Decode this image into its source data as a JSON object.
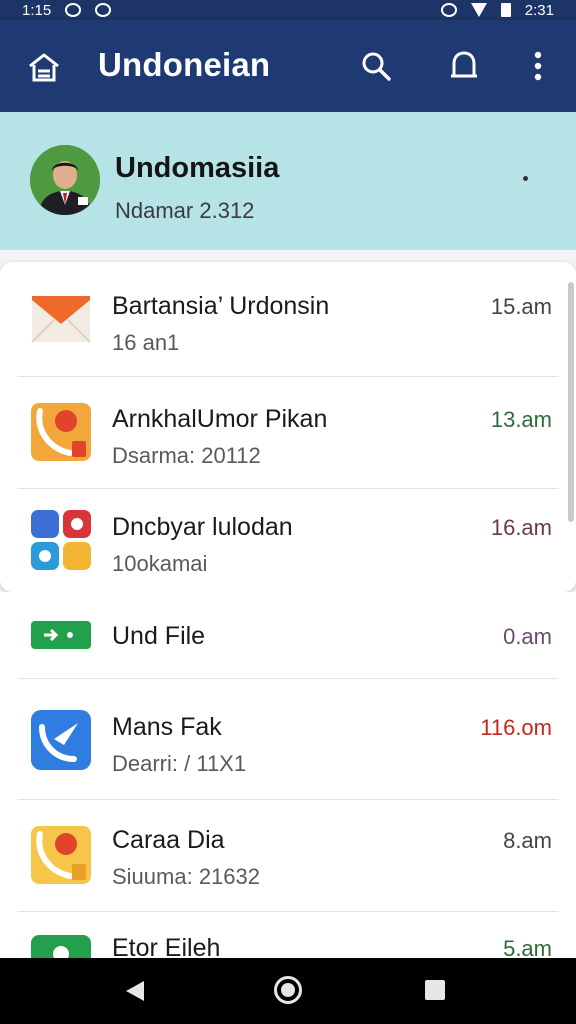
{
  "status_bar": {
    "time": "1:15",
    "clock_right": "2:31"
  },
  "app_bar": {
    "title": "Undoneian",
    "icons": [
      "home-icon",
      "search-icon",
      "bell-icon",
      "more-vert-icon"
    ]
  },
  "profile": {
    "name": "Undomasiia",
    "subtitle": "Ndamar 2.312"
  },
  "items": [
    {
      "title": "Bartansia’ Urdonsin",
      "subtitle": "16 an1",
      "time": "15.am",
      "time_color": "#444444",
      "icon": "mail-icon"
    },
    {
      "title": "ArnkhalUmor Pikan",
      "subtitle": "Dsarma: 20112",
      "time": "13.am",
      "time_color": "#2e6b3a",
      "icon": "phone-app-icon"
    },
    {
      "title": "Dncbyar lulodan",
      "subtitle": "10okamai",
      "time": "16.am",
      "time_color": "#6a3b45",
      "icon": "apps-grid-icon"
    },
    {
      "title": "Und File",
      "subtitle": "",
      "time": "0.am",
      "time_color": "#6a4a6e",
      "icon": "file-icon"
    },
    {
      "title": "Mans Fak",
      "subtitle": "Dearri: / 11X1",
      "time": "116.om",
      "time_color": "#c0281c",
      "icon": "call-app-icon"
    },
    {
      "title": "Caraa Dia",
      "subtitle": "Siuuma: 21632",
      "time": "8.am",
      "time_color": "#444444",
      "icon": "phone-app-icon"
    },
    {
      "title": "Etor Eileh",
      "subtitle": "",
      "time": "5.am",
      "time_color": "#2e6b3a",
      "icon": "file-icon"
    }
  ],
  "colors": {
    "app_bar": "#1f3a73",
    "profile_bg": "#b5e3e6"
  }
}
